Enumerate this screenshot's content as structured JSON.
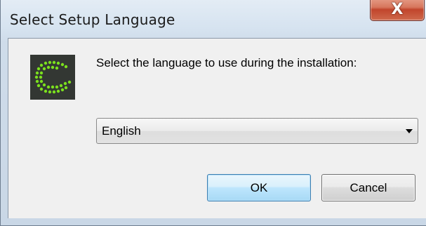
{
  "dialog": {
    "title": "Select Setup Language",
    "close_label": "X",
    "prompt": "Select the language to use during the installation:",
    "icon": "green-dotted-c-app-icon",
    "language_select": {
      "selected": "English"
    },
    "buttons": {
      "ok_label": "OK",
      "cancel_label": "Cancel"
    }
  },
  "colors": {
    "icon_background": "#333733",
    "icon_dots": "#7be01e",
    "close_button": "#c1452c",
    "ok_button_border": "#3c7fb1"
  }
}
